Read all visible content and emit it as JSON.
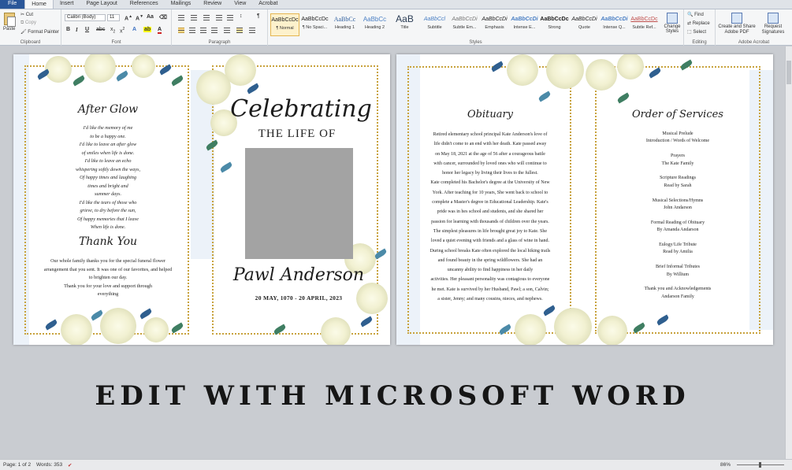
{
  "ribbon": {
    "tabs": [
      "File",
      "Home",
      "Insert",
      "Page Layout",
      "References",
      "Mailings",
      "Review",
      "View",
      "Acrobat"
    ],
    "clipboard": {
      "paste": "Paste",
      "cut": "Cut",
      "copy": "Copy",
      "format_painter": "Format Painter",
      "label": "Clipboard"
    },
    "font": {
      "name": "Calibri (Body)",
      "size": "11",
      "label": "Font"
    },
    "paragraph": {
      "label": "Paragraph"
    },
    "styles": {
      "label": "Styles",
      "items": [
        {
          "sample": "AaBbCcDc",
          "name": "¶ Normal"
        },
        {
          "sample": "AaBbCcDc",
          "name": "¶ No Spaci..."
        },
        {
          "sample": "AaBbCc",
          "name": "Heading 1"
        },
        {
          "sample": "AaBbCc",
          "name": "Heading 2"
        },
        {
          "sample": "AaB",
          "name": "Title"
        },
        {
          "sample": "AaBbCcl",
          "name": "Subtitle"
        },
        {
          "sample": "AaBbCcDi",
          "name": "Subtle Em..."
        },
        {
          "sample": "AaBbCcDi",
          "name": "Emphasis"
        },
        {
          "sample": "AaBbCcDi",
          "name": "Intense E..."
        },
        {
          "sample": "AaBbCcDc",
          "name": "Strong"
        },
        {
          "sample": "AaBbCcDi",
          "name": "Quote"
        },
        {
          "sample": "AaBbCcDi",
          "name": "Intense Q..."
        },
        {
          "sample": "AaBbCcDc",
          "name": "Subtle Ref..."
        }
      ],
      "change_styles": "Change Styles"
    },
    "editing": {
      "find": "Find",
      "replace": "Replace",
      "select": "Select",
      "label": "Editing"
    },
    "acrobat": {
      "create_share": "Create and Share Adobe PDF",
      "request_signatures": "Request Signatures",
      "label": "Adobe Acrobat"
    }
  },
  "page1": {
    "after_glow_title": "After Glow",
    "poem": [
      "I'd like the memory of me",
      "to be a happy one.",
      "I'd like to leave an after glow",
      "of smiles when life is done.",
      "I'd like to leave an echo",
      "whispering softly down the ways,",
      "Of happy times and laughing",
      "times and bright and",
      "summer days.",
      "I'd like the tears of those who",
      "grieve, to dry before the sun,",
      "Of happy memories that I leave",
      "When life is done."
    ],
    "thank_you_title": "Thank You",
    "thank_you_text": [
      "Our whole family thanks you for the special funeral flower",
      "arrangement that you sent. It was one of our favorites, and helped",
      "to brighten our day.",
      "Thank you for your love and support through",
      "everything"
    ],
    "celebrating": "Celebrating",
    "the_life_of": "THE LIFE OF",
    "name": "Pawl Anderson",
    "dates": "20 MAY, 1070 - 20 APRIL, 2023"
  },
  "page2": {
    "obituary_title": "Obituary",
    "obituary_lines": [
      "Retired elementary school principal Kate Anderson's love of",
      "life didn't come to an end with her death. Kate passed away",
      "on May 18, 2021 at the age of 56 after a courageous battle",
      "with cancer, surrounded by loved ones who will continue to",
      "honor her legacy by living their lives to the fullest.",
      "Kate completed his Bachelor's degree at the University of New",
      "York. After teaching for 10 years, She went back to school to",
      "complete a Master's degree in Educational Leadership. Kate's",
      "pride was in hes school and students, and she shared her",
      "passion for learning with thousands of children over the years.",
      "The simplest pleasures in life brought great joy to Kate. She",
      "loved a quiet evening with friends and a glass of wine in hand.",
      "During school breaks Kate often explored the local hiking trails",
      "and found beauty in the spring wildflowers. She had an",
      "uncanny ability to find happiness in her daily",
      "activities. Her pleasant personality was contagious to everyone",
      "he met. Kate is survived by her Husband, Pawl; a son, Calvin;",
      "a sister, Jenny; and many cousins, nieces, and nephews."
    ],
    "services_title": "Order of Services",
    "services": [
      {
        "title": "Musical Prelude",
        "detail": "Introduction / Words of Welcome"
      },
      {
        "title": "Prayers",
        "detail": "The Kate Family"
      },
      {
        "title": "Scripture Readings",
        "detail": "Read by Sarah"
      },
      {
        "title": "Musical Selections/Hymns",
        "detail": "John Andarson"
      },
      {
        "title": "Formal Reading of Obituary",
        "detail": "By Amanda Andarson"
      },
      {
        "title": "Eulogy/Life Tribute",
        "detail": "Read by Amilia"
      },
      {
        "title": "Brief Informal Tributes",
        "detail": "By Willium"
      },
      {
        "title": "Thank you and Acknowledgements",
        "detail": "Andarson Family"
      }
    ]
  },
  "headline": "EDIT WITH MICROSOFT WORD",
  "status": {
    "page": "Page: 1 of 2",
    "words": "Words: 353",
    "zoom": "86%"
  },
  "colors": {
    "file_tab": "#2a5699",
    "gold_frame": "#c8a23c",
    "photo_placeholder": "#a3a3a3"
  }
}
